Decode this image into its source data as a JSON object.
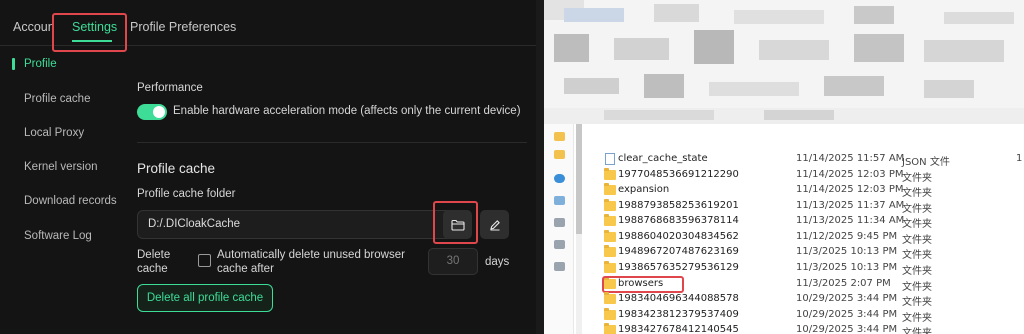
{
  "app": {
    "tabs": [
      {
        "label": "Accoun"
      },
      {
        "label": "Settings"
      },
      {
        "label": "Profile Preferences"
      }
    ],
    "sidebar": {
      "items": [
        {
          "label": "Profile"
        },
        {
          "label": "Profile cache"
        },
        {
          "label": "Local Proxy"
        },
        {
          "label": "Kernel version"
        },
        {
          "label": "Download records"
        },
        {
          "label": "Software Log"
        }
      ]
    },
    "performance": {
      "label": "Performance",
      "toggle_label": "Enable hardware acceleration mode (affects only the current device)",
      "toggle_on": true
    },
    "profile_cache": {
      "heading": "Profile cache",
      "folder_label": "Profile cache folder",
      "folder_value": "D:/.DICloakCache",
      "delete_label_1": "Delete",
      "delete_label_2": "cache",
      "auto_delete_line1": "Automatically delete unused browser",
      "auto_delete_line2": "cache after",
      "days_placeholder": "30",
      "days_unit": "days",
      "delete_all_button": "Delete all profile cache"
    },
    "colors": {
      "accent": "#3ddc97",
      "highlight": "#e0474c"
    }
  },
  "explorer": {
    "files": [
      {
        "name": "clear_cache_state",
        "date": "11/14/2025 11:57 AM",
        "type": "JSON 文件",
        "size": "1",
        "icon": "file-icon"
      },
      {
        "name": "1977048536691212290",
        "date": "11/14/2025 12:03 PM",
        "type": "文件夹",
        "icon": "folder-icon"
      },
      {
        "name": "expansion",
        "date": "11/14/2025 12:03 PM",
        "type": "文件夹",
        "icon": "folder-icon"
      },
      {
        "name": "1988793858253619201",
        "date": "11/13/2025 11:37 AM",
        "type": "文件夹",
        "icon": "folder-icon"
      },
      {
        "name": "1988768683596378114",
        "date": "11/13/2025 11:34 AM",
        "type": "文件夹",
        "icon": "folder-icon"
      },
      {
        "name": "1988604020304834562",
        "date": "11/12/2025 9:45 PM",
        "type": "文件夹",
        "icon": "folder-icon"
      },
      {
        "name": "1948967207487623169",
        "date": "11/3/2025 10:13 PM",
        "type": "文件夹",
        "icon": "folder-icon"
      },
      {
        "name": "1938657635279536129",
        "date": "11/3/2025 10:13 PM",
        "type": "文件夹",
        "icon": "folder-icon"
      },
      {
        "name": "browsers",
        "date": "11/3/2025 2:07 PM",
        "type": "文件夹",
        "icon": "folder-icon"
      },
      {
        "name": "1983404696344088578",
        "date": "10/29/2025 3:44 PM",
        "type": "文件夹",
        "icon": "folder-icon"
      },
      {
        "name": "1983423812379537409",
        "date": "10/29/2025 3:44 PM",
        "type": "文件夹",
        "icon": "folder-icon"
      },
      {
        "name": "1983427678412140545",
        "date": "10/29/2025 3:44 PM",
        "type": "文件夹",
        "icon": "folder-icon"
      }
    ]
  }
}
